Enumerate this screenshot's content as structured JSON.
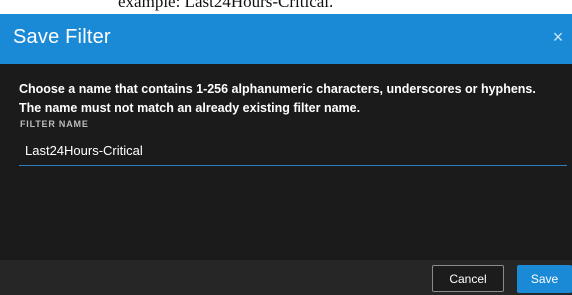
{
  "background_text": "example: Last24Hours-Critical.",
  "dialog": {
    "title": "Save Filter",
    "close_glyph": "×",
    "instructions_line1": "Choose a name that contains 1-256 alphanumeric characters, underscores or hyphens.",
    "instructions_line2": "The name must not match an already existing filter name.",
    "field_label": "FILTER NAME",
    "filter_name_value": "Last24Hours-Critical",
    "cancel_label": "Cancel",
    "save_label": "Save"
  },
  "colors": {
    "header": "#1a89d6",
    "body": "#1b1b1b",
    "footer": "#262626",
    "accent": "#1a89d6"
  }
}
